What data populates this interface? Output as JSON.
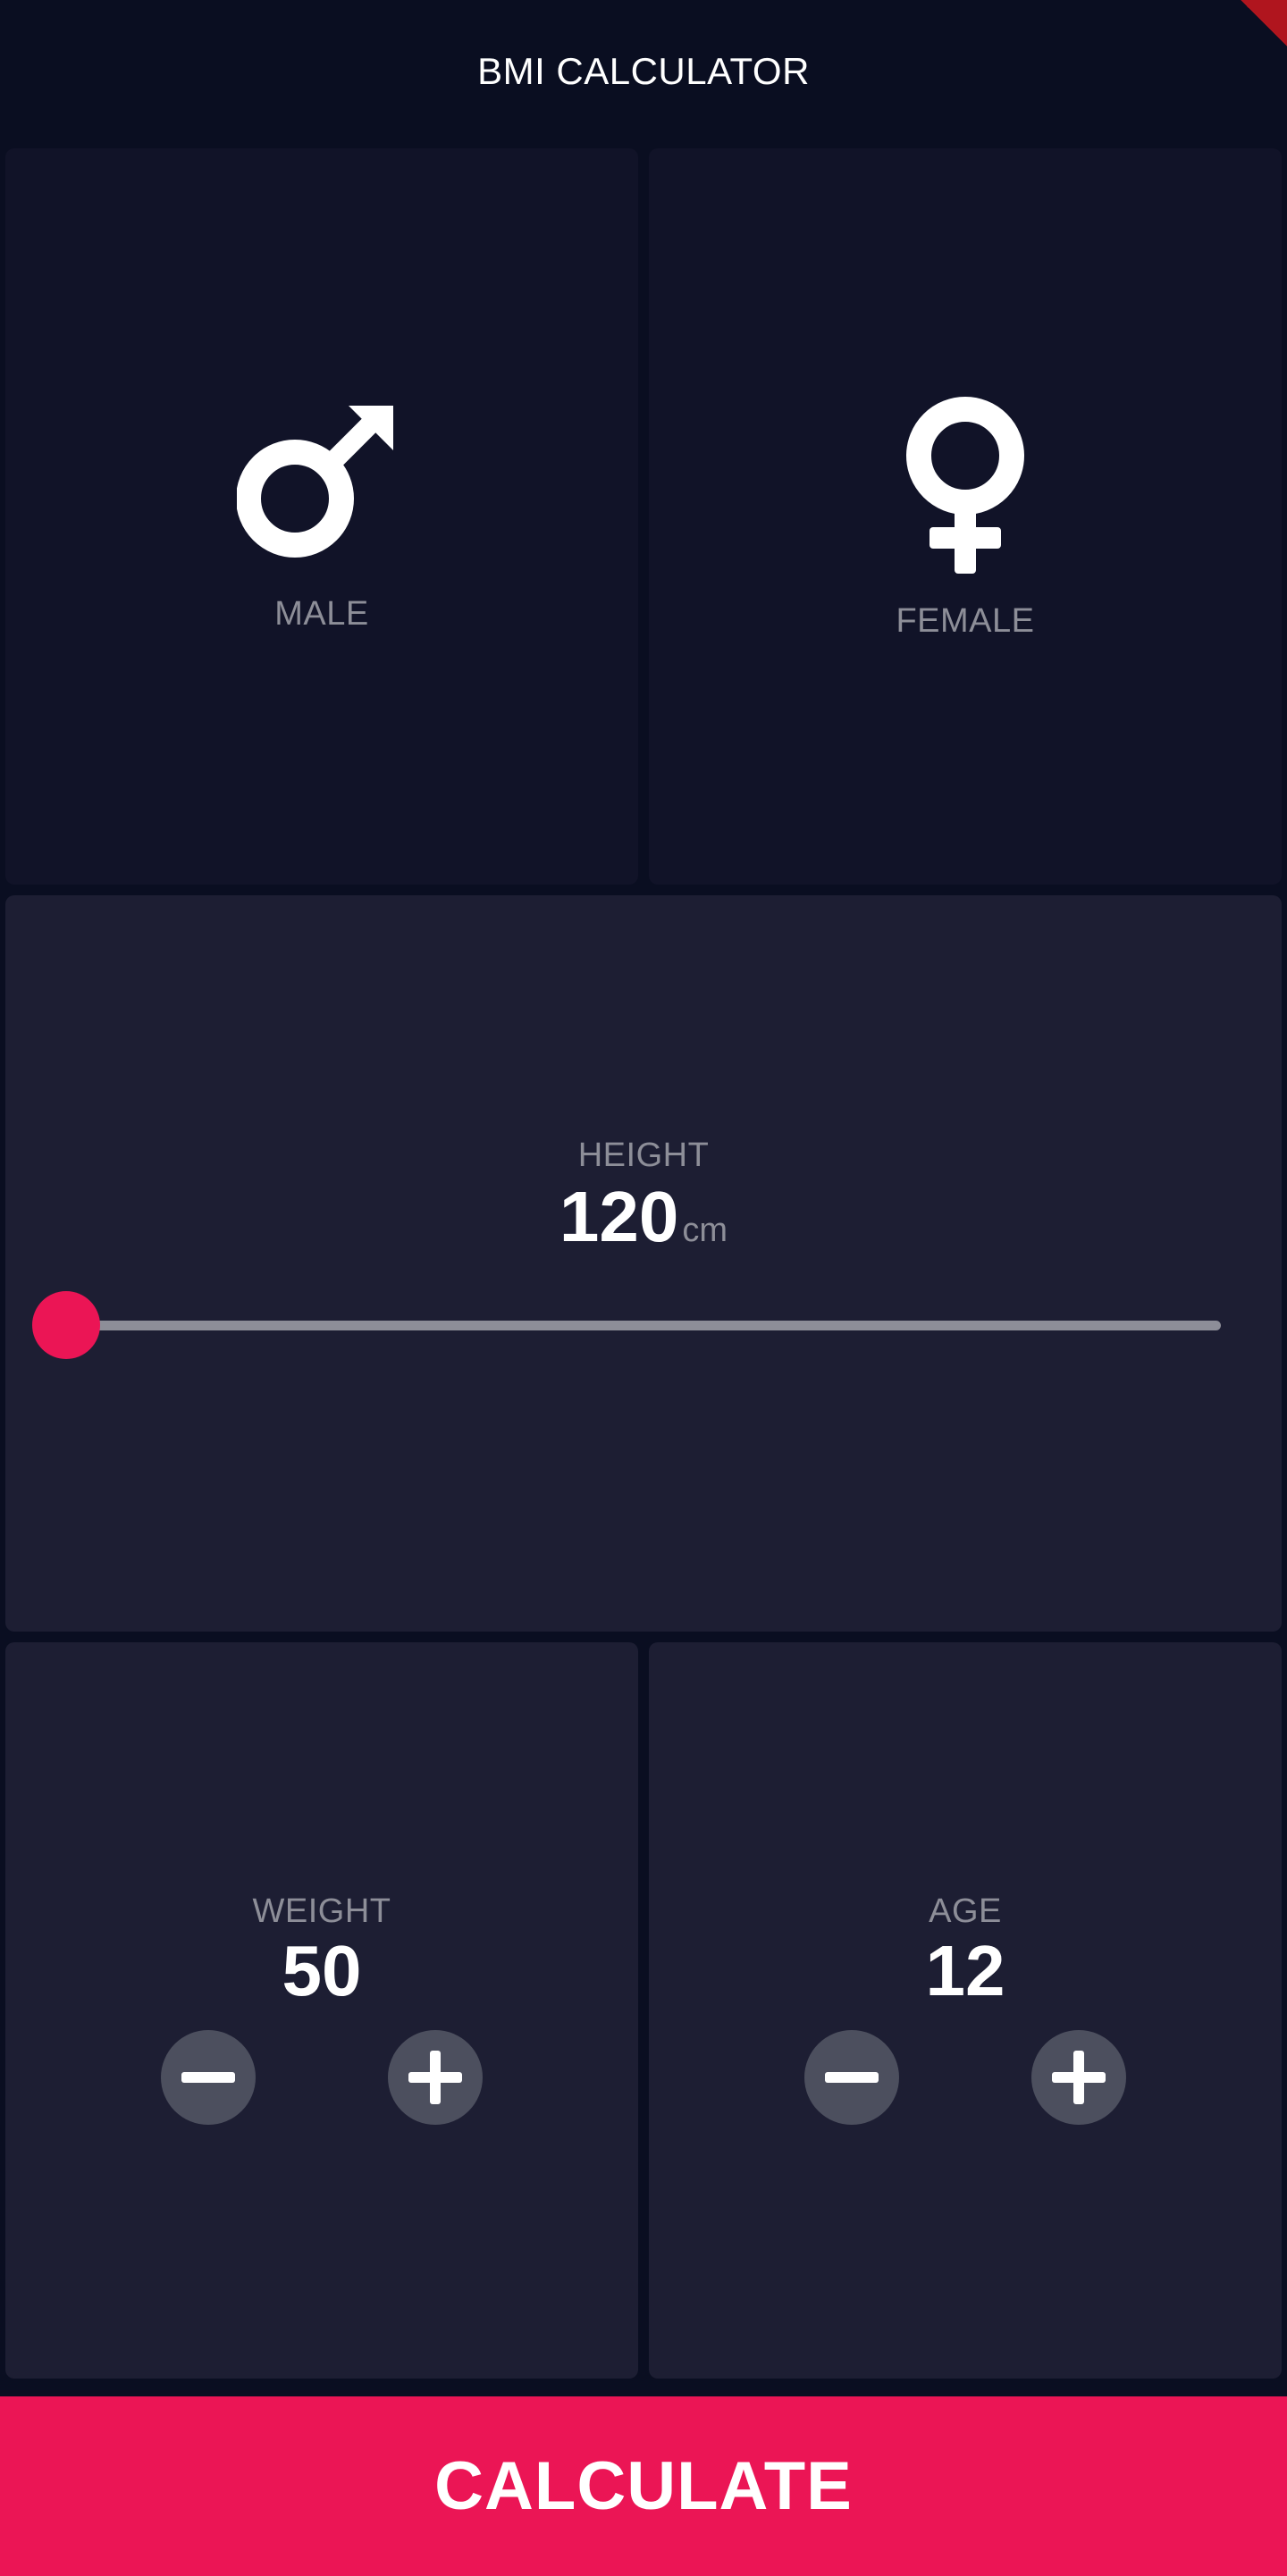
{
  "app_bar": {
    "title": "BMI CALCULATOR"
  },
  "gender": {
    "male": {
      "label": "MALE",
      "icon": "male-symbol-icon"
    },
    "female": {
      "label": "FEMALE",
      "icon": "female-symbol-icon"
    }
  },
  "height": {
    "label": "HEIGHT",
    "value": "120",
    "unit": "cm",
    "slider_fraction": 0.0
  },
  "weight": {
    "label": "WEIGHT",
    "value": "50",
    "minus_icon": "minus-icon",
    "plus_icon": "plus-icon"
  },
  "age": {
    "label": "AGE",
    "value": "12",
    "minus_icon": "minus-icon",
    "plus_icon": "plus-icon"
  },
  "calculate": {
    "label": "CALCULATE"
  },
  "colors": {
    "background": "#0a0e21",
    "card_active": "#1d1e33",
    "card_inactive": "#111328",
    "accent": "#eb1555",
    "label_grey": "#8d8e98",
    "button_grey": "#4c4f5e"
  }
}
